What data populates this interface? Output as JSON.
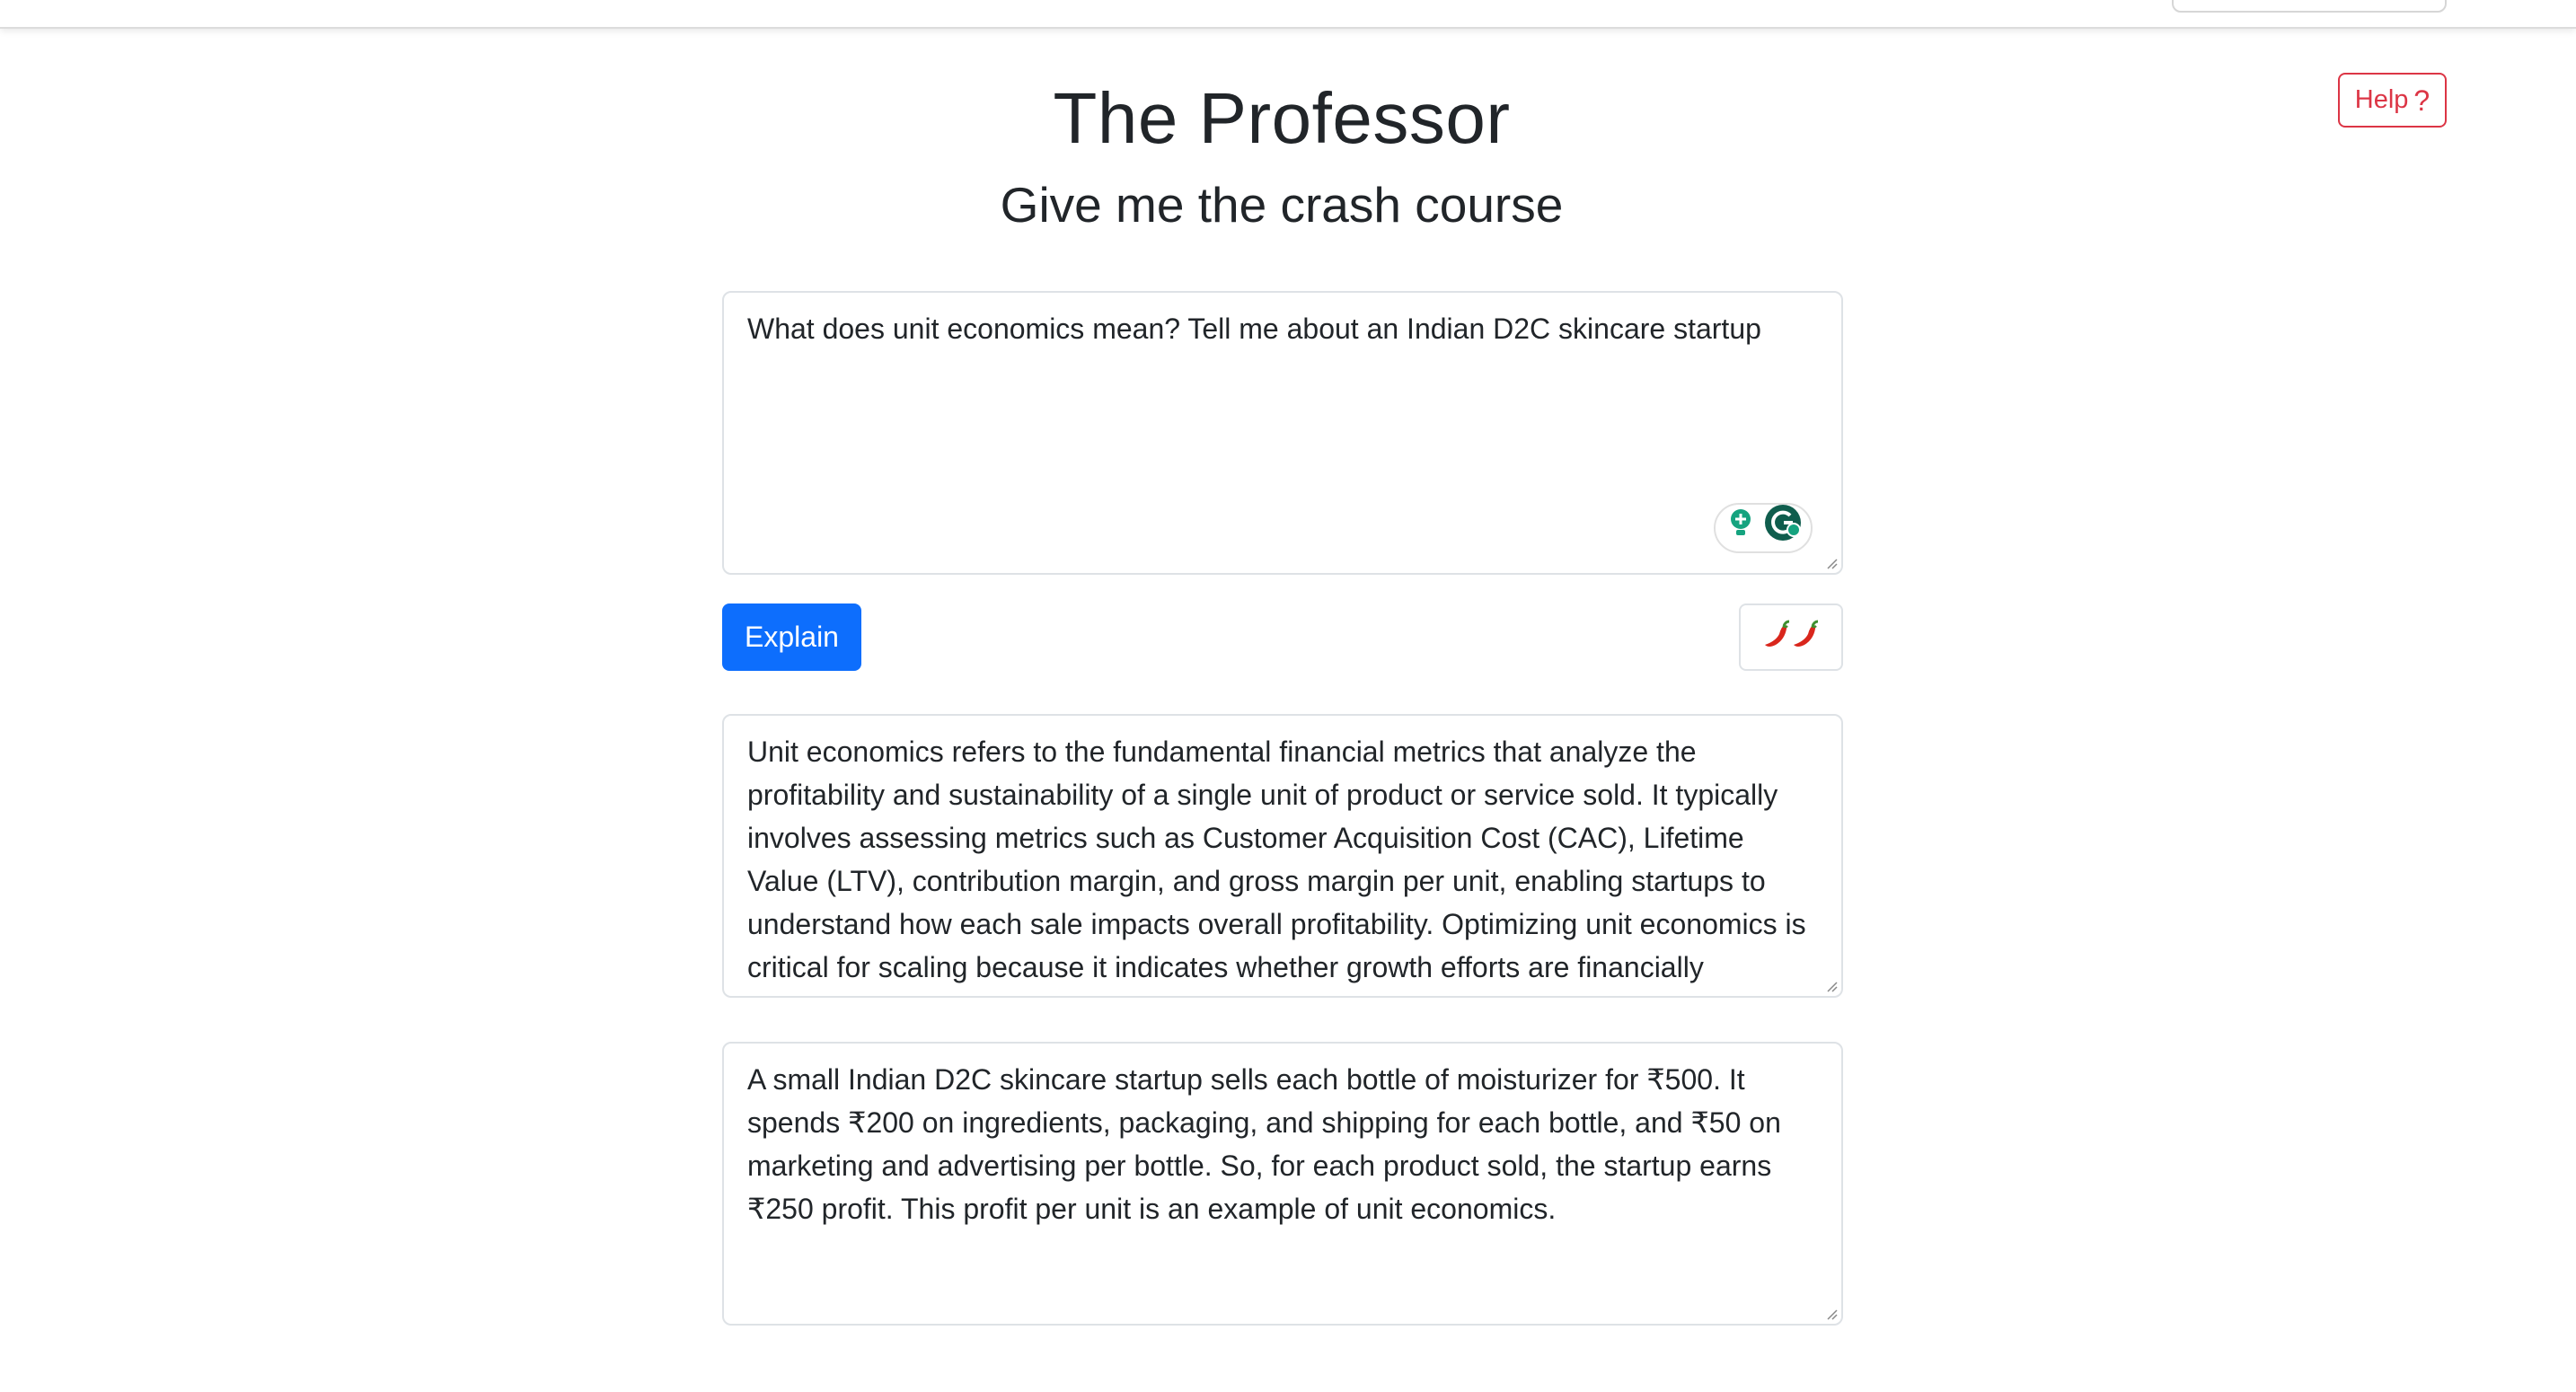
{
  "header": {
    "title": "The Professor",
    "subtitle": "Give me the crash course",
    "help_label": "Help",
    "help_icon": "?"
  },
  "prompt": {
    "value": "What does unit economics mean? Tell me about an Indian D2C skincare startup"
  },
  "actions": {
    "explain_label": "Explain",
    "spice_icon": "chili-pepper-icon",
    "spice_level": 2
  },
  "answer": {
    "text": "Unit economics refers to the fundamental financial metrics that analyze the profitability and sustainability of a single unit of product or service sold. It typically involves assessing metrics such as Customer Acquisition Cost (CAC), Lifetime Value (LTV), contribution margin, and gross margin per unit, enabling startups to understand how each sale impacts overall profitability. Optimizing unit economics is critical for scaling because it indicates whether growth efforts are financially"
  },
  "example": {
    "text": "A small Indian D2C skincare startup sells each bottle of moisturizer for ₹500. It spends ₹200 on ingredients, packaging, and shipping for each bottle, and ₹50 on marketing and advertising per bottle. So, for each product sold, the startup earns ₹250 profit. This profit per unit is an example of unit economics."
  },
  "extension_icons": [
    "grammar-suggestion-icon",
    "grammarly-icon"
  ],
  "colors": {
    "primary": "#0d6efd",
    "danger": "#dc3545",
    "extension_green": "#15a37f",
    "extension_dark": "#0f5d4d"
  }
}
